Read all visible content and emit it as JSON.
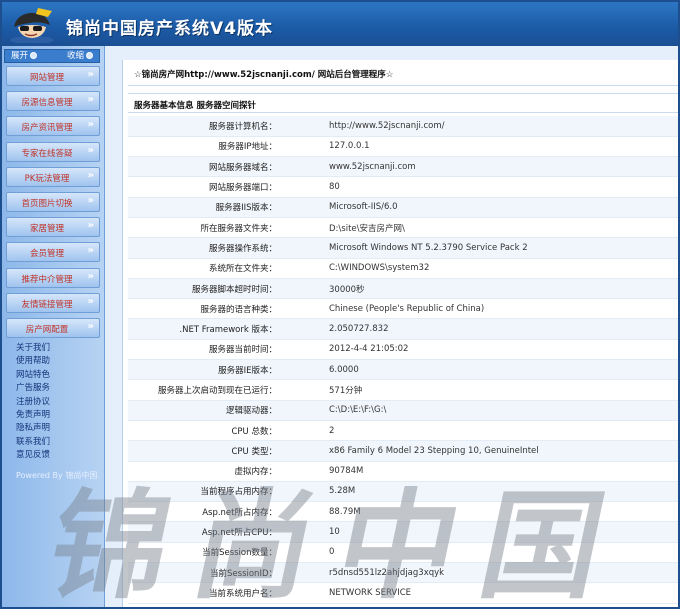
{
  "header": {
    "title": "锦尚中国房产系统V4版本",
    "logo_icon": "cartoon-man-logo-icon"
  },
  "sidebar": {
    "expand_label": "展开",
    "collapse_label": "收缩",
    "menu": [
      {
        "label": "网站管理"
      },
      {
        "label": "房源信息管理"
      },
      {
        "label": "房产资讯管理"
      },
      {
        "label": "专家在线答疑"
      },
      {
        "label": "PK玩法管理"
      },
      {
        "label": "首页图片切换"
      },
      {
        "label": "家居管理"
      },
      {
        "label": "会员管理"
      },
      {
        "label": "推荐中介管理"
      },
      {
        "label": "友情链接管理"
      },
      {
        "label": "房产网配置"
      }
    ],
    "links": [
      "关于我们",
      "使用帮助",
      "网站特色",
      "广告服务",
      "注册协议",
      "免责声明",
      "隐私声明",
      "联系我们",
      "意见反馈"
    ],
    "powered": "Powered By 锦尚中国"
  },
  "main": {
    "site_header": "☆锦尚房产网http://www.52jscnanji.com/ 网站后台管理程序☆",
    "section_title": "服务器基本信息 服务器空间探针",
    "rows": [
      {
        "label": "服务器计算机名：",
        "value": "http://www.52jscnanji.com/"
      },
      {
        "label": "服务器IP地址：",
        "value": "127.0.0.1"
      },
      {
        "label": "网站服务器域名：",
        "value": "www.52jscnanji.com"
      },
      {
        "label": "网站服务器端口：",
        "value": "80"
      },
      {
        "label": "服务器IIS版本：",
        "value": "Microsoft-IIS/6.0"
      },
      {
        "label": "所在服务器文件夹：",
        "value": "D:\\site\\安吉房产网\\"
      },
      {
        "label": "服务器操作系统：",
        "value": "Microsoft Windows NT 5.2.3790 Service Pack 2"
      },
      {
        "label": "系统所在文件夹：",
        "value": "C:\\WINDOWS\\system32"
      },
      {
        "label": "服务器脚本超时时间：",
        "value": "30000秒"
      },
      {
        "label": "服务器的语言种类：",
        "value": "Chinese (People's Republic of China)"
      },
      {
        "label": ".NET Framework 版本：",
        "value": "2.050727.832"
      },
      {
        "label": "服务器当前时间：",
        "value": "2012-4-4 21:05:02"
      },
      {
        "label": "服务器IE版本：",
        "value": "6.0000"
      },
      {
        "label": "服务器上次启动到现在已运行：",
        "value": "571分钟"
      },
      {
        "label": "逻辑驱动器：",
        "value": "C:\\D:\\E:\\F:\\G:\\"
      },
      {
        "label": "CPU 总数：",
        "value": "2"
      },
      {
        "label": "CPU 类型：",
        "value": "x86 Family 6 Model 23 Stepping 10, GenuineIntel"
      },
      {
        "label": "虚拟内存：",
        "value": "90784M"
      },
      {
        "label": "当前程序占用内存：",
        "value": "5.28M"
      },
      {
        "label": "Asp.net所占内存：",
        "value": "88.79M"
      },
      {
        "label": "Asp.net所占CPU：",
        "value": "10"
      },
      {
        "label": "当前Session数量：",
        "value": "0"
      },
      {
        "label": "当前SessionID：",
        "value": "r5dnsd551lz2ahjdjag3xqyk"
      },
      {
        "label": "当前系统用户名：",
        "value": "NETWORK SERVICE"
      }
    ]
  },
  "watermark": "锦尚中国"
}
